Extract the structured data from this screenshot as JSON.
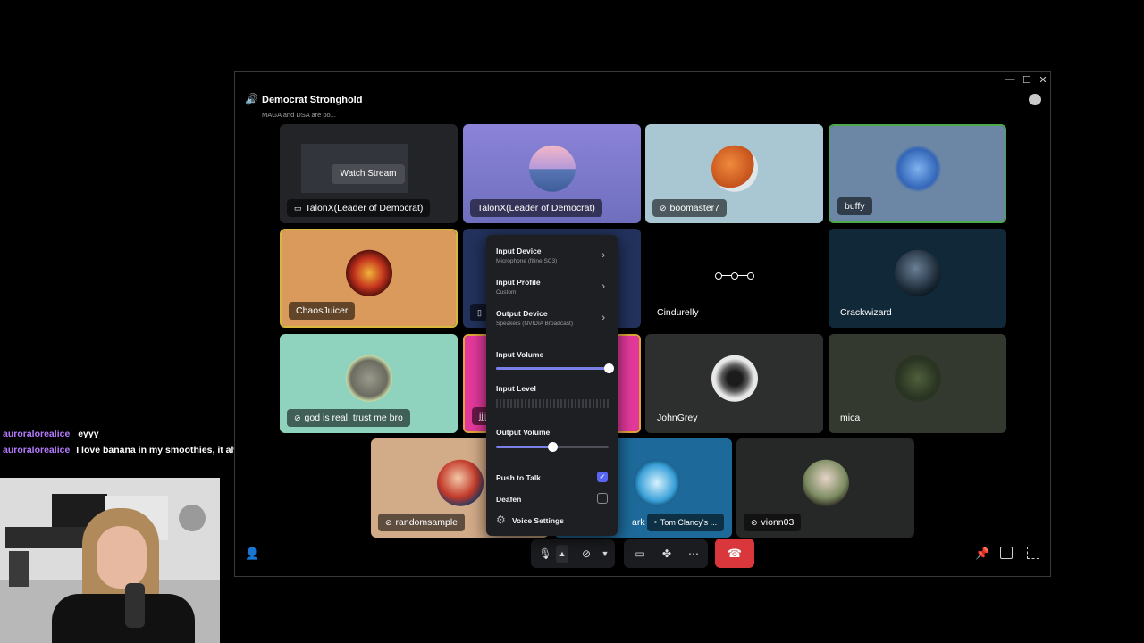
{
  "window": {
    "channel_name": "Democrat Stronghold",
    "channel_status": "MAGA and DSA are po...",
    "controls": {
      "minimize": "—",
      "maximize": "☐",
      "close": "✕"
    }
  },
  "tiles": [
    {
      "name": "TalonX(Leader of Democrat)",
      "icon": "screen-share-icon",
      "overlay": "Watch Stream",
      "bg": "#2b2b2f"
    },
    {
      "name": "TalonX(Leader of Democrat)",
      "icon": "",
      "bg": "#8e86d8"
    },
    {
      "name": "boomaster7",
      "icon": "headphones-muted-icon",
      "bg": "#a7c6d3"
    },
    {
      "name": "buffy",
      "icon": "",
      "bg": "#6c87a6"
    },
    {
      "name": "ChaosJuicer",
      "icon": "",
      "bg": "#d99a5c"
    },
    {
      "name": "",
      "icon": "mobile-icon",
      "bg": "#22325c"
    },
    {
      "name": "Cindurelly",
      "icon": "",
      "bg": "#000000"
    },
    {
      "name": "Crackwizard",
      "icon": "",
      "bg": "#112838"
    },
    {
      "name": "god is real, trust me bro",
      "icon": "headphones-muted-icon",
      "bg": "#8fd3bf"
    },
    {
      "name": "jjjj",
      "icon": "",
      "bg": "#e4399c"
    },
    {
      "name": "JohnGrey",
      "icon": "",
      "bg": "#2d2f2e"
    },
    {
      "name": "mica",
      "icon": "",
      "bg": "#33392e"
    },
    {
      "name": "randomsample",
      "icon": "headphones-muted-icon",
      "bg": "#d2ab89"
    },
    {
      "name": "ark",
      "icon": "",
      "bg": "#1d6a9a",
      "secondary": "Tom Clancy's ..."
    },
    {
      "name": "vionn03",
      "icon": "headphones-muted-icon",
      "bg": "#262827"
    }
  ],
  "voice_menu": {
    "input_device": {
      "label": "Input Device",
      "value": "Microphone (fifine SC3)"
    },
    "input_profile": {
      "label": "Input Profile",
      "value": "Custom"
    },
    "output_device": {
      "label": "Output Device",
      "value": "Speakers (NVIDIA Broadcast)"
    },
    "input_volume": {
      "label": "Input Volume",
      "level": 1.0
    },
    "input_level": {
      "label": "Input Level"
    },
    "output_volume": {
      "label": "Output Volume",
      "level": 0.5
    },
    "push_to_talk": {
      "label": "Push to Talk",
      "checked": true
    },
    "deafen": {
      "label": "Deafen",
      "checked": false
    },
    "voice_settings": {
      "label": "Voice Settings"
    }
  },
  "colors": {
    "accent": "#5865f2",
    "slider": "#7b7fe8",
    "hangup": "#da373c",
    "speaking": "#4ea84e"
  },
  "chat": [
    {
      "user": "auroralorealice",
      "text": "eyyy"
    },
    {
      "user": "auroralorealice",
      "text": "I love banana in my smoothies, it always needs it"
    }
  ]
}
